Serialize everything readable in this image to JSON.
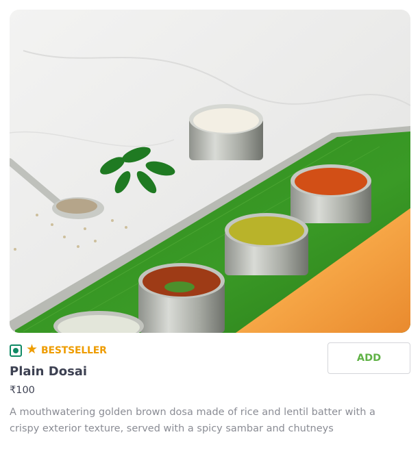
{
  "item": {
    "image_alt": "Plain Dosai with sambar and chutneys on a banana leaf",
    "veg_icon": "veg-indicator-icon",
    "badge_icon": "star-icon",
    "badge": "BESTSELLER",
    "name": "Plain Dosai",
    "price": "₹100",
    "description": "A mouthwatering golden brown dosa made of rice and lentil batter with a crispy exterior texture, served with a spicy sambar and chutneys",
    "add_label": "ADD"
  },
  "colors": {
    "bestseller": "#ee9c00",
    "veg": "#0f8a65",
    "add_text": "#60b246",
    "title": "#3d4152",
    "description": "#8a8c94"
  }
}
